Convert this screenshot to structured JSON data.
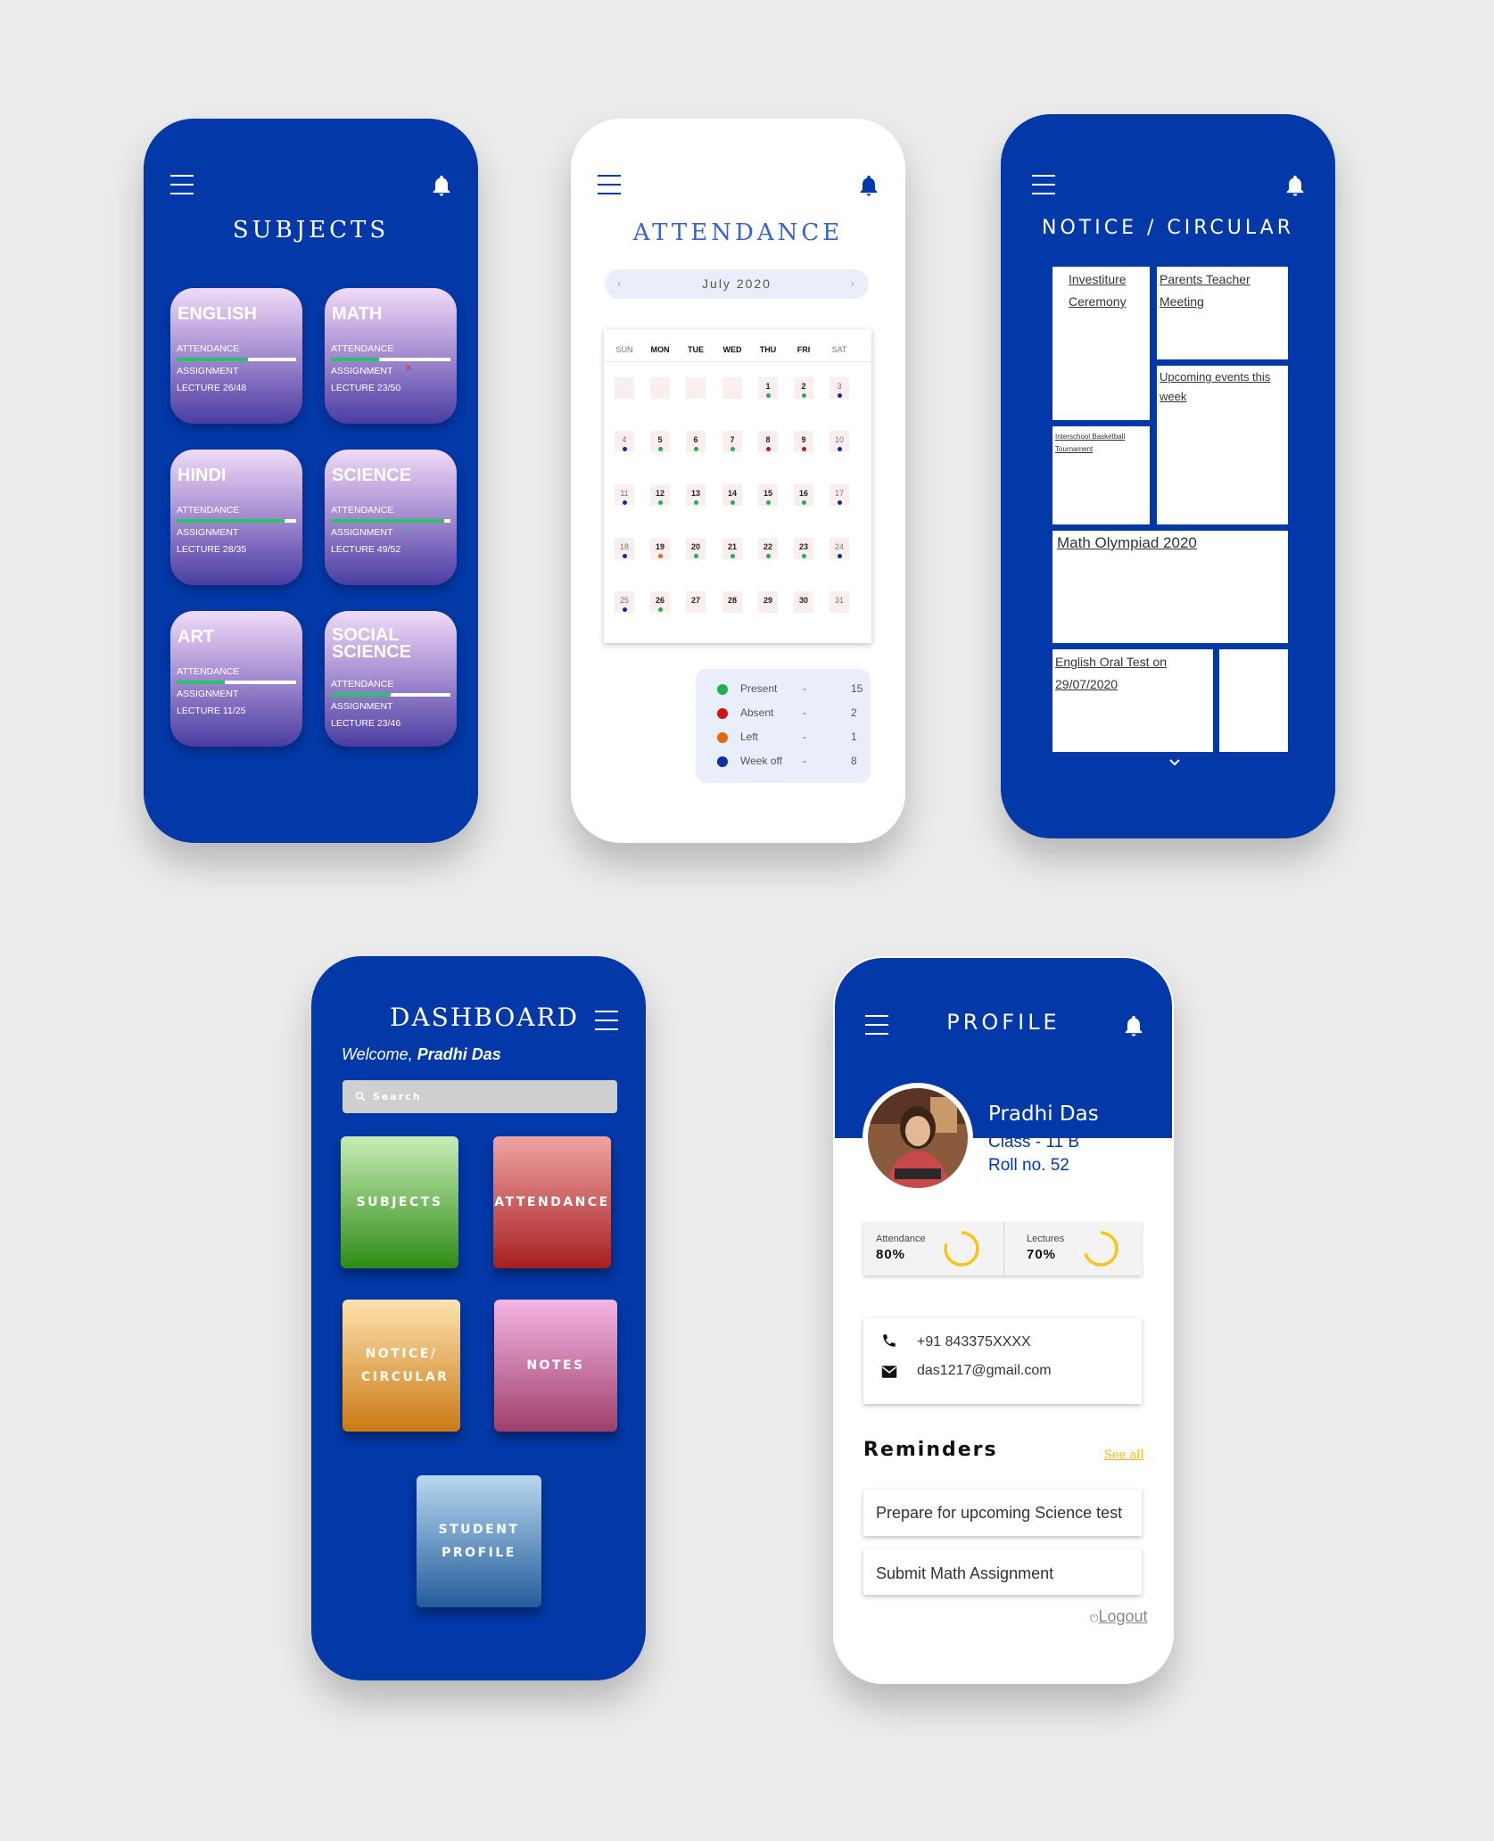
{
  "colors": {
    "primary_blue": "#0238a7",
    "present": "#1db34f",
    "absent": "#c81717",
    "left": "#e06a10",
    "week_off": "#0a2fa0",
    "accent_yellow": "#f5c518"
  },
  "subjects": {
    "title": "SUBJECTS",
    "cards": [
      {
        "name": "ENGLISH",
        "attendance_label": "ATTENDANCE",
        "attendance_fraction": 0.6,
        "assignment_label": "ASSIGNMENT",
        "assignment_status": "done",
        "lecture": "LECTURE 26/48"
      },
      {
        "name": "MATH",
        "attendance_label": "ATTENDANCE",
        "attendance_fraction": 0.4,
        "assignment_label": "ASSIGNMENT",
        "assignment_status": "pending",
        "lecture": "LECTURE 23/50"
      },
      {
        "name": "HINDI",
        "attendance_label": "ATTENDANCE",
        "attendance_fraction": 0.9,
        "assignment_label": "ASSIGNMENT",
        "assignment_status": "done",
        "lecture": "LECTURE 28/35"
      },
      {
        "name": "SCIENCE",
        "attendance_label": "ATTENDANCE",
        "attendance_fraction": 0.95,
        "assignment_label": "ASSIGNMENT",
        "assignment_status": "done",
        "lecture": "LECTURE 49/52"
      },
      {
        "name": "ART",
        "attendance_label": "ATTENDANCE",
        "attendance_fraction": 0.4,
        "assignment_label": "ASSIGNMENT",
        "assignment_status": "done",
        "lecture": "LECTURE 11/25"
      },
      {
        "name": "SOCIAL SCIENCE",
        "attendance_label": "ATTENDANCE",
        "attendance_fraction": 0.5,
        "assignment_label": "ASSIGNMENT",
        "assignment_status": "done",
        "lecture": "LECTURE 23/46"
      }
    ]
  },
  "attendance": {
    "title": "ATTENDANCE",
    "month": "July 2020",
    "weekdays": [
      "SUN",
      "MON",
      "TUE",
      "WED",
      "THU",
      "FRI",
      "SAT"
    ],
    "days": [
      {
        "d": "",
        "s": ""
      },
      {
        "d": "",
        "s": ""
      },
      {
        "d": "",
        "s": ""
      },
      {
        "d": "",
        "s": ""
      },
      {
        "d": "1",
        "s": "present"
      },
      {
        "d": "2",
        "s": "present"
      },
      {
        "d": "3",
        "s": "week_off"
      },
      {
        "d": "4",
        "s": "week_off"
      },
      {
        "d": "5",
        "s": "present"
      },
      {
        "d": "6",
        "s": "present"
      },
      {
        "d": "7",
        "s": "present"
      },
      {
        "d": "8",
        "s": "absent"
      },
      {
        "d": "9",
        "s": "absent"
      },
      {
        "d": "10",
        "s": "week_off"
      },
      {
        "d": "11",
        "s": "week_off"
      },
      {
        "d": "12",
        "s": "present"
      },
      {
        "d": "13",
        "s": "present"
      },
      {
        "d": "14",
        "s": "present"
      },
      {
        "d": "15",
        "s": "present"
      },
      {
        "d": "16",
        "s": "present"
      },
      {
        "d": "17",
        "s": "week_off"
      },
      {
        "d": "18",
        "s": "week_off"
      },
      {
        "d": "19",
        "s": "left"
      },
      {
        "d": "20",
        "s": "present"
      },
      {
        "d": "21",
        "s": "present"
      },
      {
        "d": "22",
        "s": "present"
      },
      {
        "d": "23",
        "s": "present"
      },
      {
        "d": "24",
        "s": "week_off"
      },
      {
        "d": "25",
        "s": "week_off"
      },
      {
        "d": "26",
        "s": "present"
      },
      {
        "d": "27",
        "s": ""
      },
      {
        "d": "28",
        "s": ""
      },
      {
        "d": "29",
        "s": ""
      },
      {
        "d": "30",
        "s": ""
      },
      {
        "d": "31",
        "s": ""
      }
    ],
    "legend": [
      {
        "label": "Present",
        "dash": "-",
        "value": "15",
        "key": "present"
      },
      {
        "label": "Absent",
        "dash": "-",
        "value": "2",
        "key": "absent"
      },
      {
        "label": "Left",
        "dash": "-",
        "value": "1",
        "key": "left"
      },
      {
        "label": "Week off",
        "dash": "-",
        "value": "8",
        "key": "week_off"
      }
    ]
  },
  "notice": {
    "title": "NOTICE / CIRCULAR",
    "items": {
      "investiture": "Investiture Ceremony",
      "ptm": "Parents Teacher Meeting",
      "upcoming": "Upcoming events this week",
      "basketball": "Interschool Basketball Tournament",
      "olympiad": "Math Olympiad 2020",
      "oral_test": "English Oral Test on 29/07/2020"
    }
  },
  "dashboard": {
    "title": "DASHBOARD",
    "welcome_prefix": "Welcome, ",
    "user_name": "Pradhi Das",
    "search_placeholder": "Search",
    "tiles": {
      "subjects": "SUBJECTS",
      "attendance": "ATTENDANCE",
      "notice": "NOTICE/ CIRCULAR",
      "notes": "NOTES",
      "profile": "STUDENT PROFILE"
    }
  },
  "profile": {
    "title": "PROFILE",
    "name": "Pradhi Das",
    "class": "Class - 11 B",
    "roll": "Roll no. 52",
    "attendance_label": "Attendance",
    "attendance_value": "80%",
    "attendance_fraction": 0.8,
    "lectures_label": "Lectures",
    "lectures_value": "70%",
    "lectures_fraction": 0.7,
    "phone": "+91 843375XXXX",
    "email": "das1217@gmail.com",
    "reminders_title": "Reminders",
    "see_all": "See all",
    "reminders": [
      "Prepare for upcoming Science test",
      "Submit Math Assignment"
    ],
    "logout": "Logout"
  }
}
